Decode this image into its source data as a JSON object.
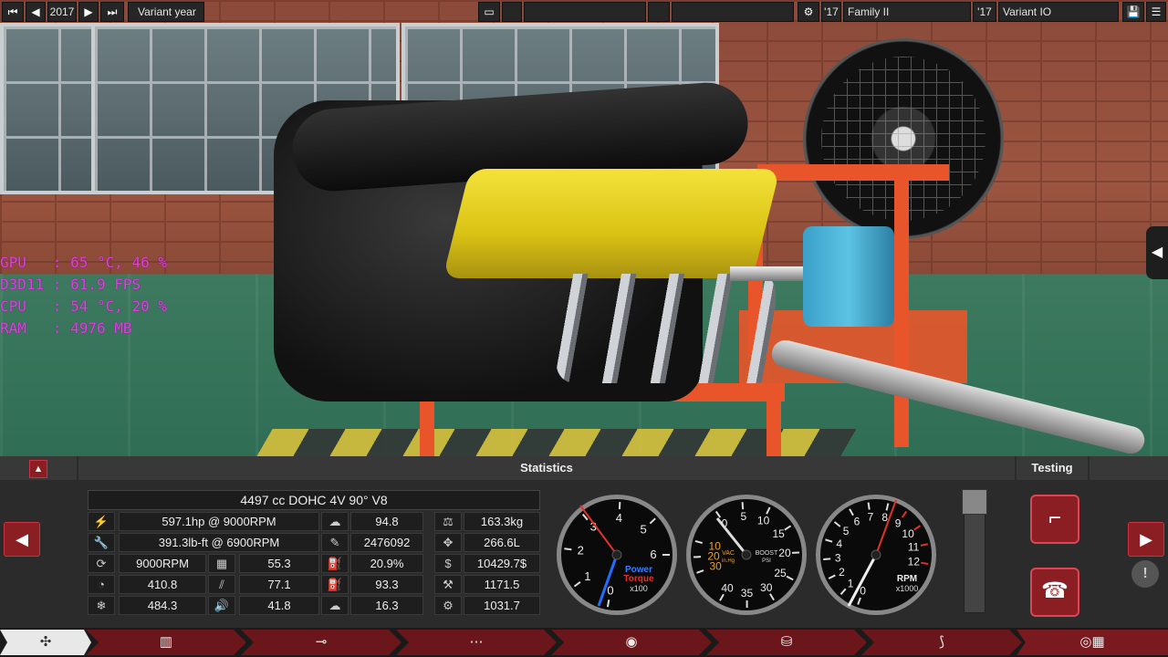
{
  "topbar": {
    "year": "2017",
    "variant_year_label": "Variant year",
    "family_year": "'17",
    "family_name": "Family II",
    "variant_year": "'17",
    "variant_name": "Variant IO"
  },
  "overlay": {
    "gpu": "GPU   : 65 °C, 46 %",
    "d3d": "D3D11 : 61.9 FPS",
    "cpu": "CPU   : 54 °C, 20 %",
    "ram": "RAM   : 4976 MB"
  },
  "panel": {
    "statistics_title": "Statistics",
    "testing_title": "Testing",
    "engine_spec": "4497 cc DOHC 4V 90° V8",
    "power": "597.1hp @ 9000RPM",
    "torque": "391.3lb-ft @ 6900RPM",
    "redline": "9000RPM",
    "v1": "55.3",
    "v2": "410.8",
    "v3": "77.1",
    "v4": "484.3",
    "v5": "41.8",
    "c2_1": "94.8",
    "c2_2": "2476092",
    "c2_3": "20.9%",
    "c2_4": "93.3",
    "c2_5": "16.3",
    "c3_1": "163.3kg",
    "c3_2": "266.6L",
    "c3_3": "10429.7$",
    "c3_4": "1171.5",
    "c3_5": "1031.7"
  },
  "gauges": {
    "power": {
      "label1": "Power",
      "label2": "Torque",
      "unit": "x100",
      "ticks": [
        "0",
        "1",
        "2",
        "3",
        "4",
        "5",
        "6"
      ],
      "power_color": "#1e6fff",
      "torque_color": "#e0312a"
    },
    "vac": {
      "label": "VAC",
      "label_sub": "in.Hg",
      "boost": "BOOST",
      "boost_sub": "PSI",
      "ticks_vac": [
        "10",
        "20",
        "30"
      ],
      "ticks_boost": [
        "0",
        "5",
        "10",
        "15",
        "20",
        "25",
        "30",
        "35",
        "40"
      ],
      "vac_color": "#f0a020"
    },
    "rpm": {
      "label": "RPM",
      "unit": "x1000",
      "ticks": [
        "0",
        "1",
        "2",
        "3",
        "4",
        "5",
        "6",
        "7",
        "8",
        "9",
        "10",
        "11",
        "12"
      ],
      "redline_color": "#e0312a"
    }
  },
  "colors": {
    "accent": "#8b1e22",
    "overlay_text": "#e040e0"
  }
}
